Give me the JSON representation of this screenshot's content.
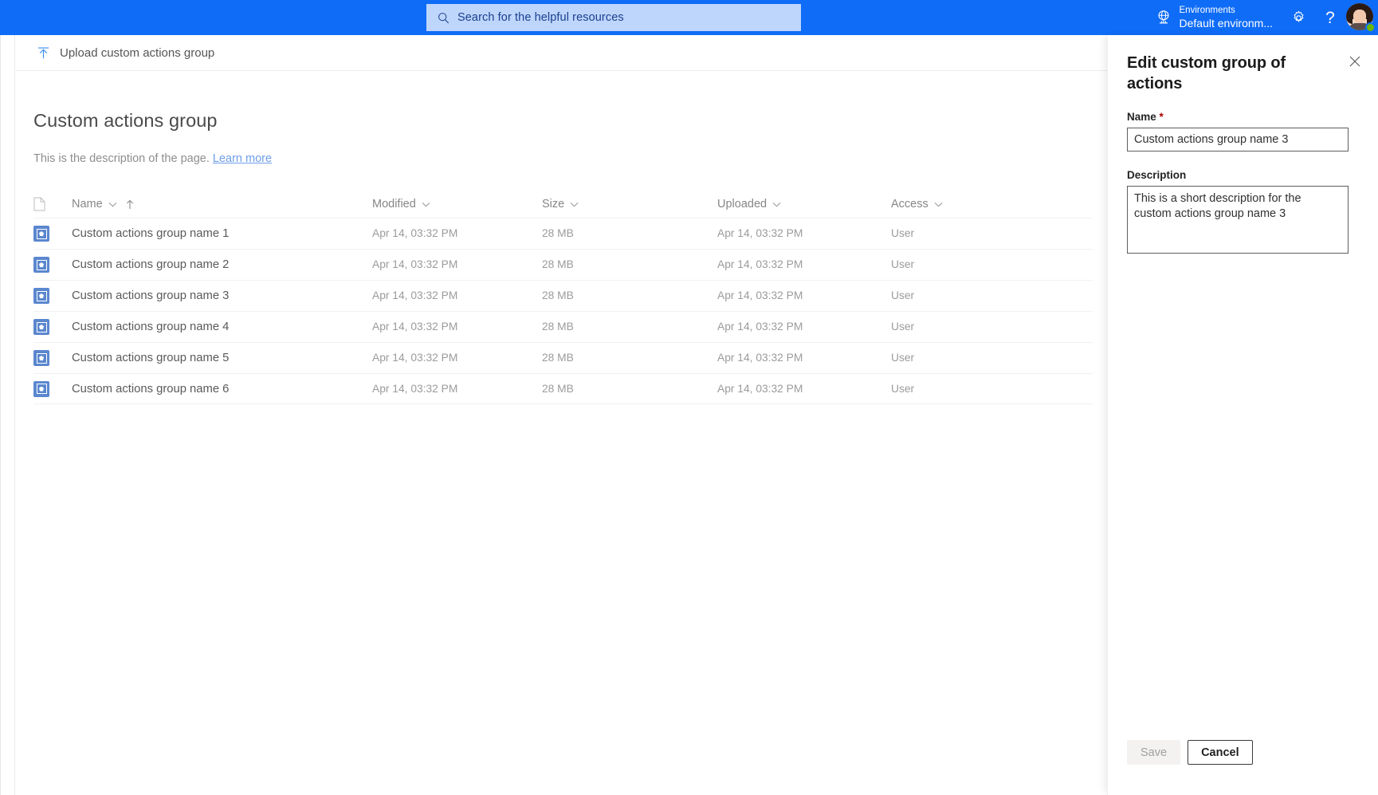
{
  "topbar": {
    "search": {
      "placeholder": "Search for the helpful resources",
      "icon": "search-icon"
    },
    "environment": {
      "label": "Environments",
      "value": "Default environm...",
      "icon": "globe-environment-icon"
    },
    "settings_icon": "gear-icon",
    "help_icon": "help-question-icon",
    "avatar": "user-avatar",
    "presence": "available",
    "colors": {
      "bar": "#0f6cf7",
      "search_field": "#bed6fb",
      "presence": "#6bb700"
    }
  },
  "command_bar": {
    "upload_label": "Upload custom actions group",
    "upload_icon": "upload-icon"
  },
  "page": {
    "title": "Custom actions group",
    "description": "This is the description of the page.",
    "learn_more": "Learn more"
  },
  "table": {
    "columns": [
      {
        "key": "icon",
        "label": "",
        "icon": "document-icon"
      },
      {
        "key": "name",
        "label": "Name",
        "sorted": "ascending"
      },
      {
        "key": "modified",
        "label": "Modified"
      },
      {
        "key": "size",
        "label": "Size"
      },
      {
        "key": "uploaded",
        "label": "Uploaded"
      },
      {
        "key": "access",
        "label": "Access"
      }
    ],
    "rows": [
      {
        "name": "Custom actions group name 1",
        "modified": "Apr 14, 03:32 PM",
        "size": "28 MB",
        "uploaded": "Apr 14, 03:32 PM",
        "access": "User"
      },
      {
        "name": "Custom actions group name 2",
        "modified": "Apr 14, 03:32 PM",
        "size": "28 MB",
        "uploaded": "Apr 14, 03:32 PM",
        "access": "User"
      },
      {
        "name": "Custom actions group name 3",
        "modified": "Apr 14, 03:32 PM",
        "size": "28 MB",
        "uploaded": "Apr 14, 03:32 PM",
        "access": "User"
      },
      {
        "name": "Custom actions group name 4",
        "modified": "Apr 14, 03:32 PM",
        "size": "28 MB",
        "uploaded": "Apr 14, 03:32 PM",
        "access": "User"
      },
      {
        "name": "Custom actions group name 5",
        "modified": "Apr 14, 03:32 PM",
        "size": "28 MB",
        "uploaded": "Apr 14, 03:32 PM",
        "access": "User"
      },
      {
        "name": "Custom actions group name 6",
        "modified": "Apr 14, 03:32 PM",
        "size": "28 MB",
        "uploaded": "Apr 14, 03:32 PM",
        "access": "User"
      }
    ]
  },
  "panel": {
    "title": "Edit custom group of actions",
    "close_icon": "close-icon",
    "name_field": {
      "label": "Name",
      "required_marker": "*",
      "value": "Custom actions group name 3"
    },
    "description_field": {
      "label": "Description",
      "value": "This is a short description for the custom actions group name 3"
    },
    "save_label": "Save",
    "save_disabled": true,
    "cancel_label": "Cancel"
  }
}
